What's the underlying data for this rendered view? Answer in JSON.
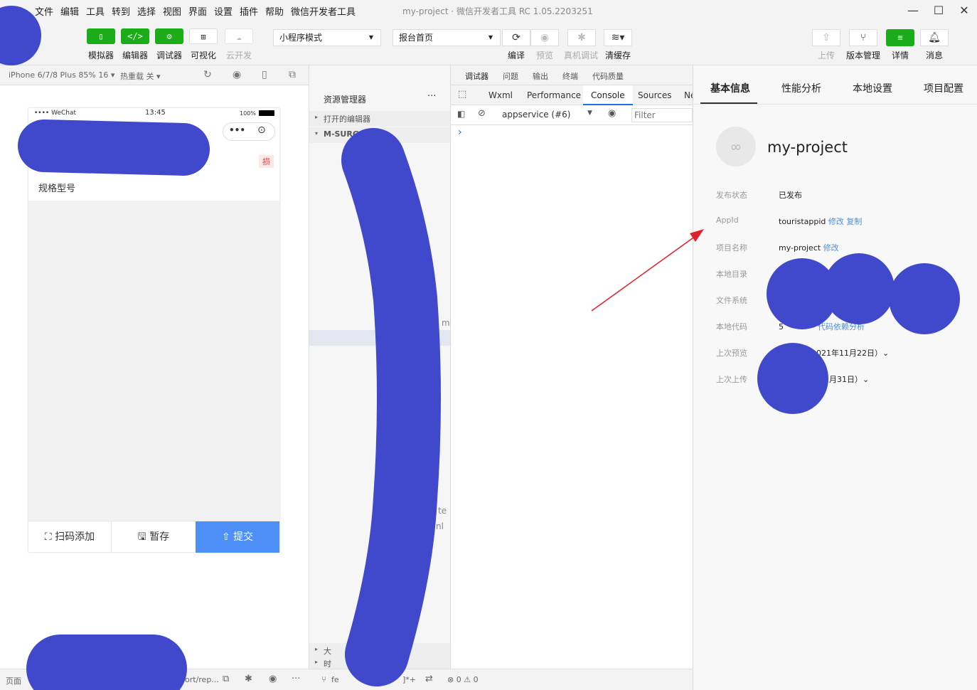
{
  "menubar": {
    "items": [
      "文件",
      "编辑",
      "工具",
      "转到",
      "选择",
      "视图",
      "界面",
      "设置",
      "插件",
      "帮助",
      "微信开发者工具"
    ],
    "window_title": "my-project · 微信开发者工具 RC 1.05.2203251",
    "minimize": "—",
    "maximize": "☐",
    "close": "✕"
  },
  "toolbar": {
    "simulator_label": "模拟器",
    "editor_label": "编辑器",
    "debugger_label": "调试器",
    "visual_label": "可视化",
    "cloud_label": "云开发",
    "mode_select": "小程序模式",
    "page_select": "报台首页",
    "compile_label": "编译",
    "preview_label": "预览",
    "remote_debug_label": "真机调试",
    "clear_cache_label": "清缓存",
    "upload_label": "上传",
    "version_label": "版本管理",
    "details_label": "详情",
    "messages_label": "消息"
  },
  "simulator": {
    "device": "iPhone 6/7/8 Plus 85% 16 ▾",
    "hot_reload": "热重载 关 ▾",
    "status_carrier": "•••• WeChat",
    "status_time": "13:45",
    "status_battery": "100%",
    "badge": "损",
    "row_label": "规格型号",
    "bottom": {
      "scan_add": "扫码添加",
      "save_draft": "暂存",
      "submit": "提交"
    }
  },
  "explorer": {
    "title": "资源管理器",
    "more": "···",
    "open_editors": "打开的编辑器",
    "project_root": "M-SURG",
    "partial_1": "ml",
    "partial_2": "te",
    "partial_3": "nl",
    "section_a": "大",
    "section_b": "时"
  },
  "devtools": {
    "tabs": [
      "调试器",
      "问题",
      "输出",
      "终端",
      "代码质量"
    ],
    "sub_tabs": [
      "Wxml",
      "Performance",
      "Console",
      "Sources",
      "Ne"
    ],
    "context": "appservice (#6)",
    "filter_placeholder": "Filter",
    "prompt": "›"
  },
  "details": {
    "tabs": [
      "基本信息",
      "性能分析",
      "本地设置",
      "项目配置"
    ],
    "project_name": "my-project",
    "rows": [
      {
        "label": "发布状态",
        "value": "已发布",
        "link": ""
      },
      {
        "label": "AppId",
        "value": "touristappid",
        "link": "修改 复制"
      },
      {
        "label": "项目名称",
        "value": "my-project",
        "link": "修改"
      },
      {
        "label": "本地目录",
        "value": "",
        "link": ""
      },
      {
        "label": "文件系统",
        "value": "",
        "link": ""
      },
      {
        "label": "本地代码",
        "value": "5",
        "link": "代码依赖分析"
      },
      {
        "label": "上次预览",
        "value": "2021年11月22日）⌄",
        "link": ""
      },
      {
        "label": "上次上传",
        "value": "年12月31日）⌄",
        "link": ""
      }
    ]
  },
  "statusbar": {
    "page_path": "页面",
    "path_tail": "ort/rep...",
    "branch": "fe",
    "mark": "]*+",
    "errors": "⊗ 0 ⚠ 0"
  },
  "colors": {
    "accent_green": "#1aad19",
    "submit_blue": "#4d8ff7",
    "link_blue": "#4a90d9",
    "redaction": "#4048cc",
    "arrow_red": "#e0202a"
  }
}
